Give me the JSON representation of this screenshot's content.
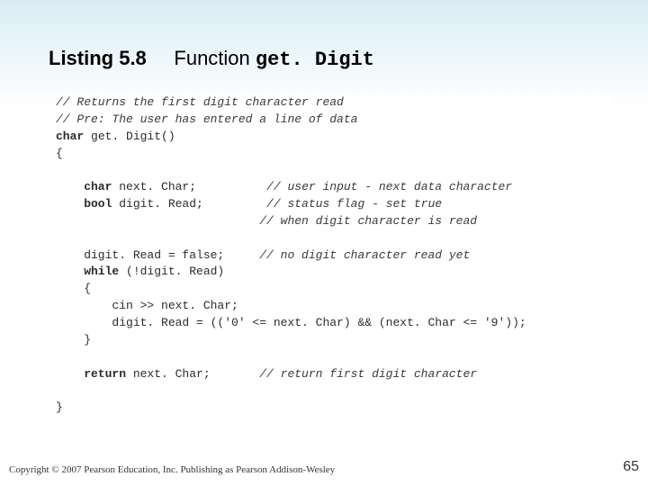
{
  "title": {
    "listing": "Listing 5.8",
    "function_word": "Function",
    "function_name": "get. Digit"
  },
  "code": {
    "c1": "// Returns the first digit character read",
    "c2": "// Pre: The user has entered a line of data",
    "sig_kw": "char",
    "sig_rest": " get. Digit()",
    "ob": "{",
    "decl1_kw": "    char",
    "decl1_rest": " next. Char;",
    "decl1_cm": "          // user input - next data character",
    "decl2_kw": "    bool",
    "decl2_rest": " digit. Read;",
    "decl2_cm": "         // status flag - set true",
    "decl3_cm": "                             // when digit character is read",
    "blank": "",
    "init": "    digit. Read = false;",
    "init_cm": "     // no digit character read yet",
    "while_kw": "    while",
    "while_rest": " (!digit. Read)",
    "ob2": "    {",
    "body1": "        cin >> next. Char;",
    "body2": "        digit. Read = (('0' <= next. Char) && (next. Char <= '9'));",
    "cb2": "    }",
    "ret_kw": "    return",
    "ret_rest": " next. Char;",
    "ret_cm": "       // return first digit character",
    "cb": "}"
  },
  "footer": {
    "copyright": "Copyright © 2007 Pearson Education, Inc. Publishing as Pearson Addison-Wesley",
    "page": "65"
  }
}
